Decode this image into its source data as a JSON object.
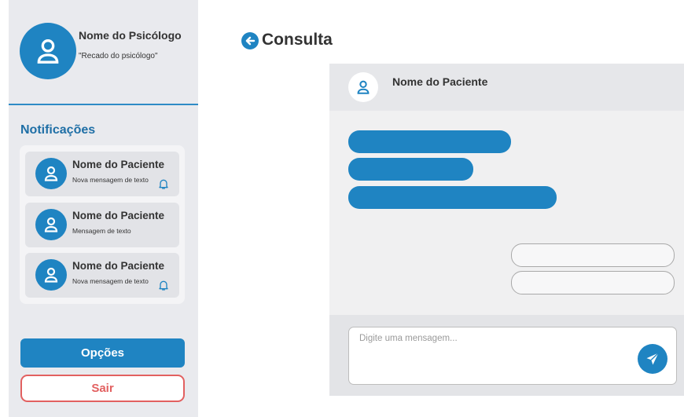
{
  "sidebar": {
    "psychologist": {
      "name": "Nome do Psicólogo",
      "note": "\"Recado do psicólogo\"",
      "avatar_icon": "user-icon"
    },
    "notifications_title": "Notificações",
    "notifications": [
      {
        "name": "Nome do Paciente",
        "message": "Nova mensagem de texto",
        "bell": true
      },
      {
        "name": "Nome do Paciente",
        "message": "Mensagem de texto",
        "bell": false
      },
      {
        "name": "Nome do Paciente",
        "message": "Nova mensagem de texto",
        "bell": true
      }
    ],
    "options_label": "Opções",
    "exit_label": "Sair"
  },
  "header": {
    "back_icon": "arrow-left-circle-icon",
    "title": "Consulta"
  },
  "chat": {
    "patient_name": "Nome do Paciente",
    "incoming_messages": 3,
    "outgoing_messages": 2,
    "composer_placeholder": "Digite uma mensagem...",
    "send_icon": "send-icon"
  },
  "colors": {
    "accent": "#1f84c2",
    "danger": "#e26060",
    "sidebar_bg": "#e9eaee",
    "chat_bg": "#f0f0f1"
  }
}
